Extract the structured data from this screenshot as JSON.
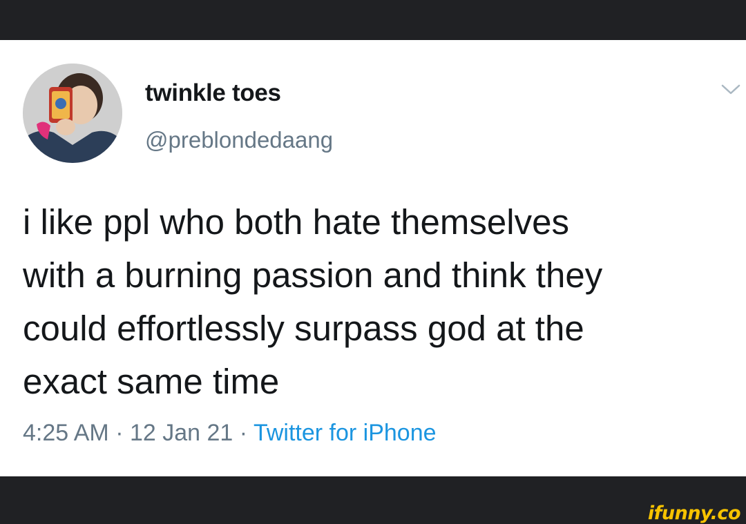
{
  "tweet": {
    "display_name": "twinkle toes",
    "handle": "@preblondedaang",
    "text_lines": [
      "i like ppl who both hate themselves",
      "with a burning passion and think they",
      "could effortlessly surpass god at the",
      "exact same time"
    ],
    "time": "4:25 AM",
    "date": "12 Jan 21",
    "separator": "·",
    "source": "Twitter for iPhone",
    "avatar_icon": "avatar-photo",
    "menu_icon": "chevron-down-icon"
  },
  "watermark": {
    "text": "ifunny.co"
  },
  "colors": {
    "name": "#14171a",
    "secondary": "#657786",
    "link": "#1b95e0",
    "frame": "#202124",
    "watermark": "#f7c300"
  }
}
